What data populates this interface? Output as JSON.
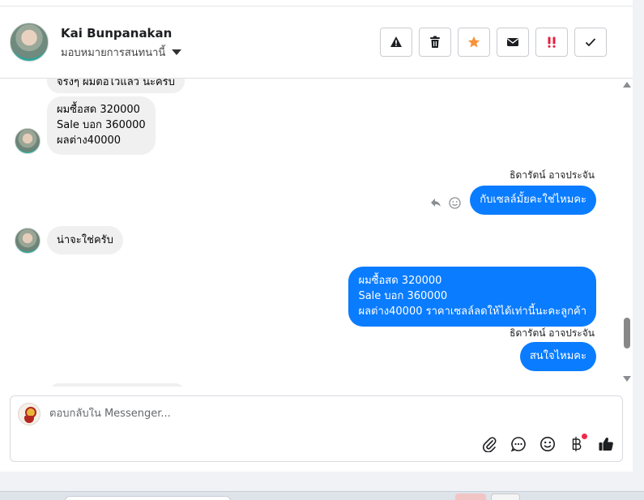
{
  "header": {
    "contact_name": "Kai Bunpanakan",
    "assign_label": "มอบหมายการสนทนานี้",
    "actions": [
      {
        "icon": "warning-icon",
        "glyph": "⚠"
      },
      {
        "icon": "trash-icon",
        "glyph": "🗑"
      },
      {
        "icon": "star-icon",
        "glyph": "★"
      },
      {
        "icon": "mail-icon",
        "glyph": "✉"
      },
      {
        "icon": "spam-icon",
        "glyph": "‼"
      },
      {
        "icon": "check-icon",
        "glyph": "✓"
      }
    ]
  },
  "messages": {
    "m0_partial": "จริงๆ ผมต่อไว้แล้ว นะครับ",
    "m1": {
      "lines": [
        "ผมซื้อสด 320000",
        "Sale บอก 360000",
        "ผลต่าง40000"
      ]
    },
    "m2_sender": "ธิดารัตน์ อาจประจัน",
    "m2": "กับเซลล์มั้ยคะใช่ไหมคะ",
    "m3": "น่าจะใช่ครับ",
    "m4": {
      "lines": [
        "ผมซื้อสด 320000",
        "Sale บอก 360000",
        "ผลต่าง40000 ราคาเซลล์ลดให้ได้เท่านี้นะคะลูกค้า"
      ]
    },
    "m5_sender": "ธิดารัตน์ อาจประจัน",
    "m5": "สนใจไหมคะ"
  },
  "composer": {
    "placeholder": "ตอบกลับใน Messenger...",
    "tools": [
      {
        "icon": "attachment-icon",
        "glyph": "📎"
      },
      {
        "icon": "saved-reply-icon",
        "glyph": "💬"
      },
      {
        "icon": "emoji-icon",
        "glyph": "☺"
      },
      {
        "icon": "payment-baht-icon",
        "glyph": "฿"
      },
      {
        "icon": "like-icon",
        "glyph": "👍"
      }
    ]
  }
}
